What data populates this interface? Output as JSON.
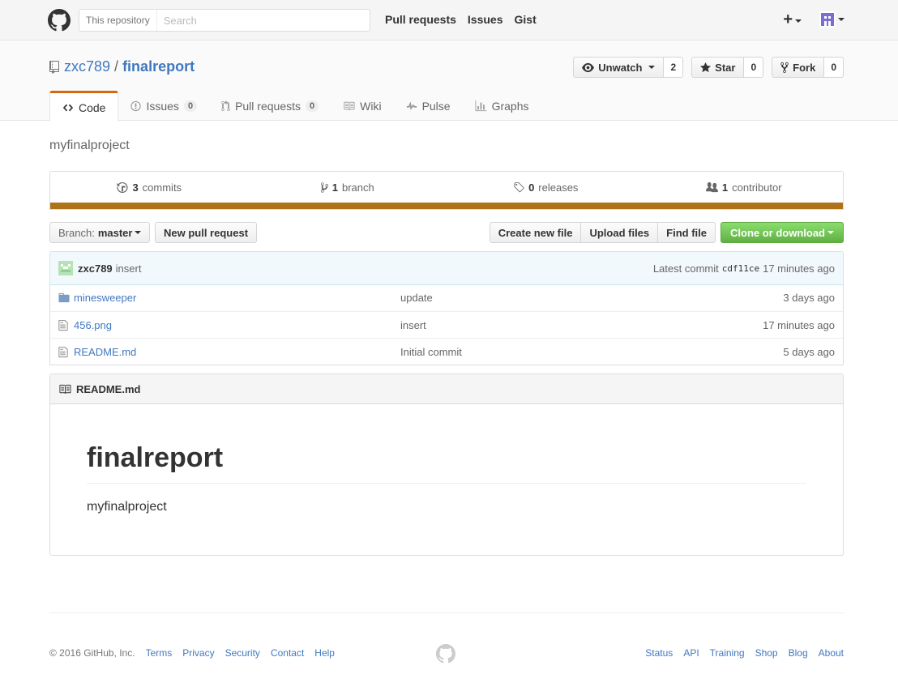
{
  "header": {
    "search_scope": "This repository",
    "search_placeholder": "Search",
    "nav": [
      "Pull requests",
      "Issues",
      "Gist"
    ]
  },
  "repo": {
    "owner": "zxc789",
    "separator": "/",
    "name": "finalreport",
    "watch_label": "Unwatch",
    "watch_count": "2",
    "star_label": "Star",
    "star_count": "0",
    "fork_label": "Fork",
    "fork_count": "0"
  },
  "tabs": [
    {
      "label": "Code"
    },
    {
      "label": "Issues",
      "count": "0"
    },
    {
      "label": "Pull requests",
      "count": "0"
    },
    {
      "label": "Wiki"
    },
    {
      "label": "Pulse"
    },
    {
      "label": "Graphs"
    }
  ],
  "description": "myfinalproject",
  "summary": {
    "commits_num": "3",
    "commits_label": "commits",
    "branch_num": "1",
    "branch_label": "branch",
    "releases_num": "0",
    "releases_label": "releases",
    "contributor_num": "1",
    "contributor_label": "contributor",
    "language_color": "#b07219"
  },
  "file_nav": {
    "branch_label": "Branch:",
    "branch_name": "master",
    "new_pr": "New pull request",
    "create_file": "Create new file",
    "upload_files": "Upload files",
    "find_file": "Find file",
    "clone": "Clone or download"
  },
  "latest_commit": {
    "author": "zxc789",
    "message": "insert",
    "label": "Latest commit",
    "sha": "cdf11ce",
    "age": "17 minutes ago"
  },
  "files": [
    {
      "icon": "folder-icon",
      "name": "minesweeper",
      "message": "update",
      "age": "3 days ago"
    },
    {
      "icon": "file-icon",
      "name": "456.png",
      "message": "insert",
      "age": "17 minutes ago"
    },
    {
      "icon": "file-icon",
      "name": "README.md",
      "message": "Initial commit",
      "age": "5 days ago"
    }
  ],
  "readme": {
    "filename": "README.md",
    "title": "finalreport",
    "body": "myfinalproject"
  },
  "footer": {
    "copyright": "© 2016 GitHub, Inc.",
    "left_links": [
      "Terms",
      "Privacy",
      "Security",
      "Contact",
      "Help"
    ],
    "right_links": [
      "Status",
      "API",
      "Training",
      "Shop",
      "Blog",
      "About"
    ]
  }
}
